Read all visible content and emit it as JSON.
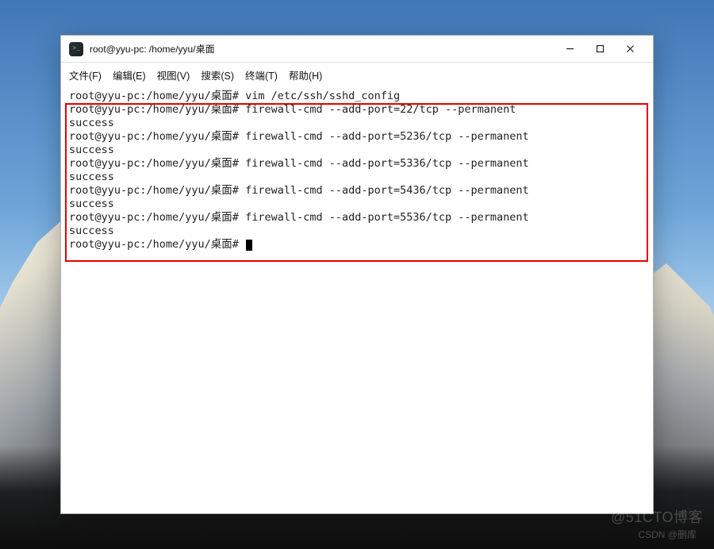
{
  "window": {
    "title": "root@yyu-pc: /home/yyu/桌面"
  },
  "menu": {
    "file": "文件(F)",
    "edit": "编辑(E)",
    "view": "视图(V)",
    "search": "搜索(S)",
    "terminal": "终端(T)",
    "help": "帮助(H)"
  },
  "terminal": {
    "lines": [
      "root@yyu-pc:/home/yyu/桌面# vim /etc/ssh/sshd_config",
      "root@yyu-pc:/home/yyu/桌面# firewall-cmd --add-port=22/tcp --permanent",
      "success",
      "root@yyu-pc:/home/yyu/桌面# firewall-cmd --add-port=5236/tcp --permanent",
      "success",
      "root@yyu-pc:/home/yyu/桌面# firewall-cmd --add-port=5336/tcp --permanent",
      "success",
      "root@yyu-pc:/home/yyu/桌面# firewall-cmd --add-port=5436/tcp --permanent",
      "success",
      "root@yyu-pc:/home/yyu/桌面# firewall-cmd --add-port=5536/tcp --permanent",
      "success"
    ],
    "prompt_last": "root@yyu-pc:/home/yyu/桌面# "
  },
  "watermarks": {
    "w1": "@51CTO博客",
    "w2": "CSDN @删库"
  }
}
